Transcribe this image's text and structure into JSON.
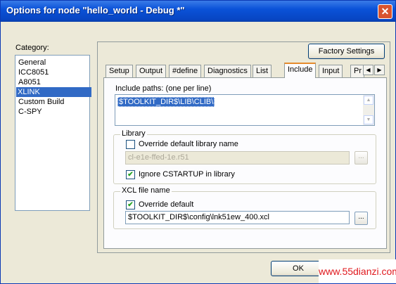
{
  "window": {
    "title": "Options for node \"hello_world - Debug *\"",
    "close_glyph": "✕"
  },
  "category": {
    "label": "Category:",
    "items": [
      {
        "label": "General"
      },
      {
        "label": "ICC8051"
      },
      {
        "label": "A8051"
      },
      {
        "label": "XLINK",
        "selected": true
      },
      {
        "label": "Custom Build"
      },
      {
        "label": "C-SPY"
      }
    ]
  },
  "factory_settings_label": "Factory Settings",
  "tabs": [
    {
      "label": "Setup"
    },
    {
      "label": "Output"
    },
    {
      "label": "#define"
    },
    {
      "label": "Diagnostics"
    },
    {
      "label": "List"
    },
    {
      "label": "Include",
      "active": true
    },
    {
      "label": "Input"
    },
    {
      "label": "Pr"
    }
  ],
  "include_paths": {
    "label": "Include paths:  (one per line)",
    "value": "$TOOLKIT_DIR$\\LIB\\CLIB\\"
  },
  "library": {
    "group_label": "Library",
    "override_label": "Override default library name",
    "override_checked": false,
    "name_value": "cl-e1e-ffed-1e.r51",
    "ignore_label": "Ignore CSTARTUP in library",
    "ignore_checked": true
  },
  "xcl": {
    "group_label": "XCL file name",
    "override_label": "Override default",
    "override_checked": true,
    "path_value": "$TOOLKIT_DIR$\\config\\lnk51ew_400.xcl"
  },
  "browse_label": "...",
  "ok_label": "OK",
  "watermark": "www.55dianzi.com",
  "colors": {
    "selection": "#316ac5",
    "titlebar": "#0a52d8",
    "active_tab_accent": "#e68b2c",
    "watermark": "#e0191e"
  }
}
